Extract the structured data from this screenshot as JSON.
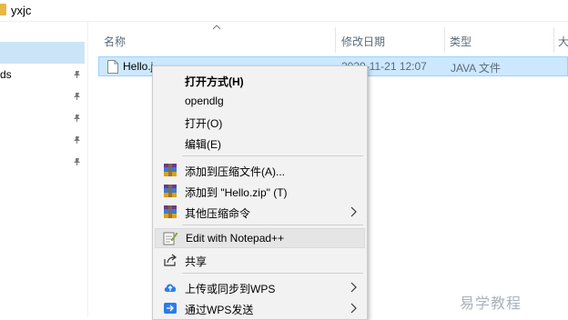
{
  "window": {
    "title": "yxjc"
  },
  "nav": {
    "items": [
      {
        "label": "ds"
      }
    ]
  },
  "columns": {
    "name": "名称",
    "date": "修改日期",
    "type": "类型",
    "size": "大"
  },
  "file": {
    "name": "Hello.j",
    "date": "2020-11-21 12:07",
    "type": "JAVA 文件"
  },
  "menu": {
    "items": [
      {
        "label": "打开方式(H)",
        "icon": "none"
      },
      {
        "label": "opendlg",
        "icon": "none"
      },
      {
        "label": "打开(O)",
        "icon": "none"
      },
      {
        "label": "编辑(E)",
        "icon": "none"
      },
      {
        "label": "添加到压缩文件(A)...",
        "icon": "winrar-icon"
      },
      {
        "label": "添加到 \"Hello.zip\" (T)",
        "icon": "winrar-icon"
      },
      {
        "label": "其他压缩命令",
        "icon": "winrar-icon",
        "submenu": true
      },
      {
        "label": "Edit with Notepad++",
        "icon": "notepadpp-icon"
      },
      {
        "label": "共享",
        "icon": "share-icon"
      },
      {
        "label": "上传或同步到WPS",
        "icon": "cloud-upload-icon",
        "submenu": true
      },
      {
        "label": "通过WPS发送",
        "icon": "wps-send-icon",
        "submenu": true
      }
    ]
  },
  "watermark": "易学教程",
  "colors": {
    "selection": "#cce8ff",
    "menu_bg": "#f2f2f2"
  }
}
